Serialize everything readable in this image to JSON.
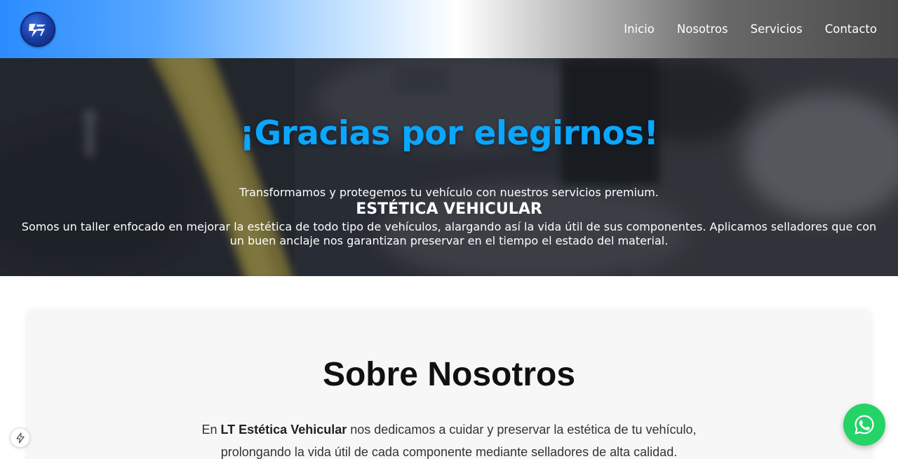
{
  "navbar": {
    "logo_icon": "brand-logo-bolt",
    "links": [
      "Inicio",
      "Nosotros",
      "Servicios",
      "Contacto"
    ]
  },
  "hero": {
    "title": "¡Gracias por elegirnos!",
    "subtitle": "Transformamos y protegemos tu vehículo con nuestros servicios premium.",
    "heading": "ESTÉTICA VEHICULAR",
    "description": "Somos un taller enfocado en mejorar la estética de todo tipo de vehículos, alargando así la vida útil de sus componentes. Aplicamos selladores que con un buen anclaje nos garantizan preservar en el tiempo el estado del material.",
    "title_color": "#0aa6ff"
  },
  "about": {
    "title": "Sobre Nosotros",
    "text_prefix": "En ",
    "brand": "LT Estética Vehicular",
    "text_suffix": " nos dedicamos a cuidar y preservar la estética de tu vehículo, prolongando la vida útil de cada componente mediante selladores de alta calidad."
  },
  "floating": {
    "whatsapp_icon": "whatsapp-icon",
    "whatsapp_color": "#25d366",
    "bolt_icon": "bolt-icon"
  }
}
